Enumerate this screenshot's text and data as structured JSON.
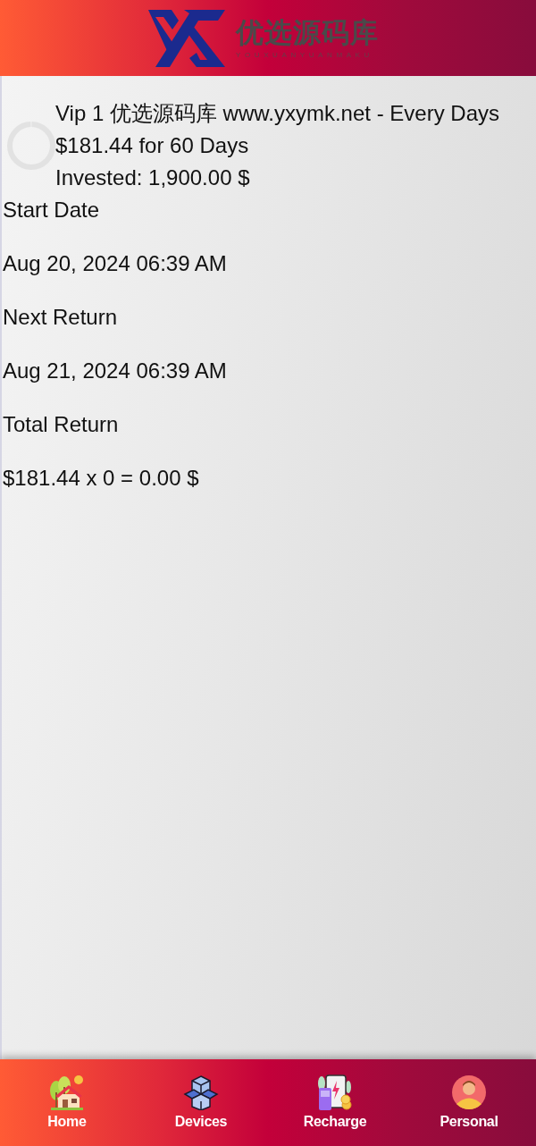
{
  "header": {
    "logo_title": "优选源码库",
    "logo_subtitle": "YOUXUANYUANMAKU"
  },
  "plan": {
    "lines": [
      "Vip 1 优选源码库 www.yxymk.net - Every Days",
      "$181.44 for 60 Days",
      "Invested: 1,900.00 $"
    ]
  },
  "details": [
    {
      "label": "Start Date",
      "value": "Aug 20, 2024 06:39 AM"
    },
    {
      "label": "Next Return",
      "value": "Aug 21, 2024 06:39 AM"
    },
    {
      "label": "Total Return",
      "value": "$181.44 x 0 = 0.00 $"
    }
  ],
  "bottom_nav": [
    {
      "label": "Home"
    },
    {
      "label": "Devices"
    },
    {
      "label": "Recharge"
    },
    {
      "label": "Personal"
    }
  ]
}
